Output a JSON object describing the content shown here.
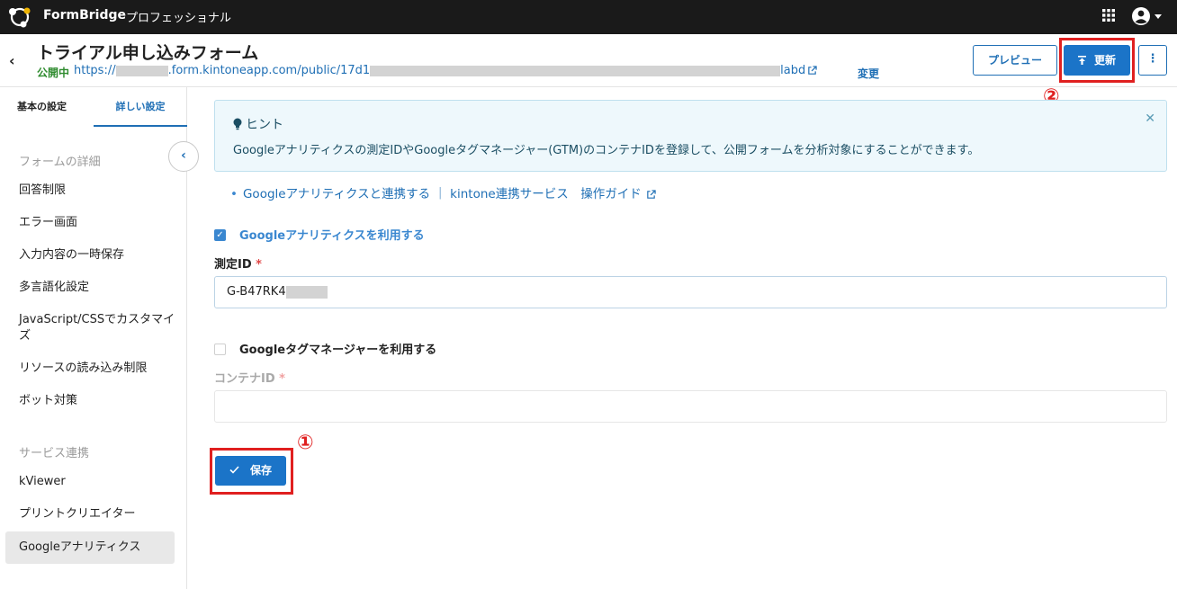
{
  "topbar": {
    "brand": "FormBridge",
    "plan": "プロフェッショナル",
    "icons": [
      "formbridge-logo-icon",
      "apps-grid-icon",
      "account-icon",
      "caret-down-icon"
    ]
  },
  "header": {
    "back_icon": "‹",
    "title": "トライアル申し込みフォーム",
    "status": "公開中",
    "url_prefix": "https://",
    "url_middle": ".form.kintoneapp.com/public/17d1",
    "url_suffix": "labd",
    "change_label": "変更",
    "preview_label": "プレビュー",
    "update_label": "更新",
    "more_label": "⋮"
  },
  "annotations": {
    "update_marker": "②",
    "save_marker": "①"
  },
  "sidebar": {
    "tabs": [
      "基本の設定",
      "詳しい設定"
    ],
    "active_tab": "詳しい設定",
    "collapse_icon": "‹",
    "section_form": "フォームの詳細",
    "items": [
      "回答制限",
      "エラー画面",
      "入力内容の一時保存",
      "多言語化設定",
      "JavaScript/CSSでカスタマイズ",
      "リソースの読み込み制限",
      "ボット対策"
    ],
    "section_service": "サービス連携",
    "service_items": [
      "kViewer",
      "プリントクリエイター",
      "Googleアナリティクス"
    ],
    "active_item": "Googleアナリティクス"
  },
  "main": {
    "hint": {
      "title": "ヒント",
      "text": "Googleアナリティクスの測定IDやGoogleタグマネージャー(GTM)のコンテナIDを登録して、公開フォームを分析対象にすることができます。",
      "close": "✕"
    },
    "guide_link": "Googleアナリティクスと連携する ｜ kintone連携サービス　操作ガイド",
    "ga_checkbox": {
      "label": "Googleアナリティクスを利用する",
      "checked": true
    },
    "measure_id": {
      "label": "測定ID",
      "required": "*",
      "value": "G-B47RK4"
    },
    "gtm_checkbox": {
      "label": "Googleタグマネージャーを利用する",
      "checked": false
    },
    "container_id": {
      "label": "コンテナID",
      "required": "*",
      "value": ""
    },
    "save_label": "保存"
  },
  "colors": {
    "accent": "#1b74c8",
    "topbar": "#1a1a1a",
    "marker": "#e02020",
    "status": "#2e8b2e"
  }
}
